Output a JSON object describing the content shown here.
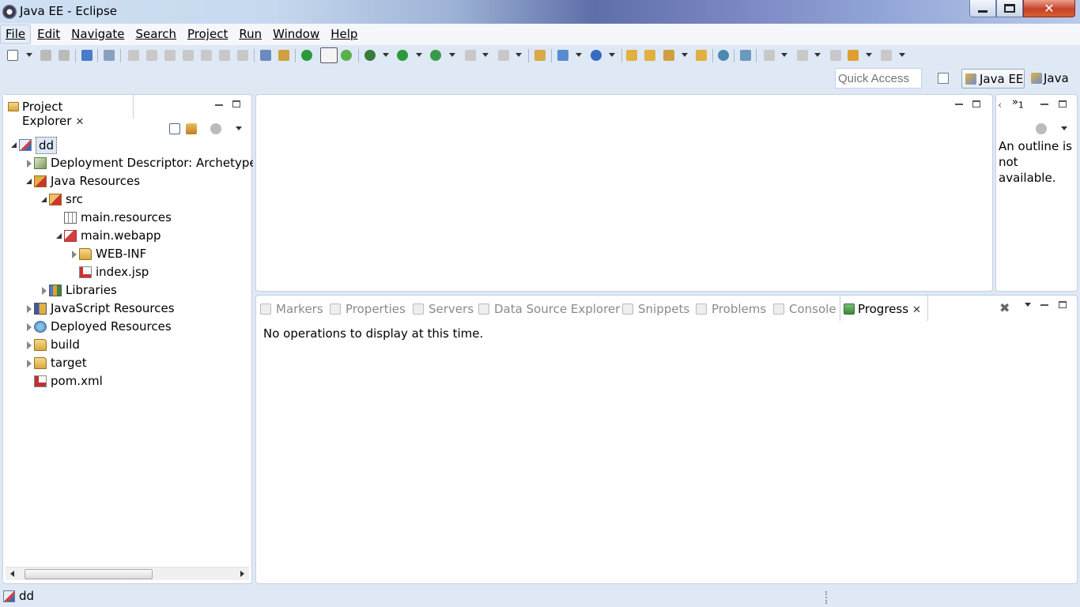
{
  "window": {
    "title": "Java EE - Eclipse",
    "close_glyph": "✕"
  },
  "menu": [
    "File",
    "Edit",
    "Navigate",
    "Search",
    "Project",
    "Run",
    "Window",
    "Help"
  ],
  "quick_access": {
    "placeholder": "Quick Access"
  },
  "perspectives": {
    "active": "Java EE",
    "other": "Java"
  },
  "project_explorer": {
    "title": "Project Explorer",
    "tree": [
      {
        "label": "dd",
        "depth": 0,
        "state": "expanded",
        "icon": "maven-web-project-icon"
      },
      {
        "label": "Deployment Descriptor: Archetype",
        "depth": 1,
        "state": "collapsed",
        "icon": "deployment-descriptor-icon"
      },
      {
        "label": "Java Resources",
        "depth": 1,
        "state": "expanded",
        "icon": "java-resources-icon"
      },
      {
        "label": "src",
        "depth": 2,
        "state": "expanded",
        "icon": "source-folder-icon"
      },
      {
        "label": "main.resources",
        "depth": 3,
        "state": "none",
        "icon": "package-icon"
      },
      {
        "label": "main.webapp",
        "depth": 3,
        "state": "expanded",
        "icon": "package-error-icon"
      },
      {
        "label": "WEB-INF",
        "depth": 4,
        "state": "collapsed",
        "icon": "folder-icon"
      },
      {
        "label": "index.jsp",
        "depth": 4,
        "state": "none",
        "icon": "jsp-file-icon"
      },
      {
        "label": "Libraries",
        "depth": 2,
        "state": "collapsed",
        "icon": "libraries-icon"
      },
      {
        "label": "JavaScript Resources",
        "depth": 1,
        "state": "collapsed",
        "icon": "javascript-resources-icon"
      },
      {
        "label": "Deployed Resources",
        "depth": 1,
        "state": "collapsed",
        "icon": "deployed-resources-icon"
      },
      {
        "label": "build",
        "depth": 1,
        "state": "collapsed",
        "icon": "folder-icon"
      },
      {
        "label": "target",
        "depth": 1,
        "state": "collapsed",
        "icon": "folder-icon"
      },
      {
        "label": "pom.xml",
        "depth": 1,
        "state": "none",
        "icon": "pom-file-icon"
      }
    ]
  },
  "outline": {
    "chevron_label": "»",
    "hidden_count": "1",
    "message": "An outline is not available."
  },
  "bottom_tabs": [
    {
      "label": "Markers",
      "icon": "markers-icon",
      "active": false
    },
    {
      "label": "Properties",
      "icon": "properties-icon",
      "active": false
    },
    {
      "label": "Servers",
      "icon": "servers-icon",
      "active": false
    },
    {
      "label": "Data Source Explorer",
      "icon": "data-source-icon",
      "active": false
    },
    {
      "label": "Snippets",
      "icon": "snippets-icon",
      "active": false
    },
    {
      "label": "Problems",
      "icon": "problems-icon",
      "active": false
    },
    {
      "label": "Console",
      "icon": "console-icon",
      "active": false
    },
    {
      "label": "Progress",
      "icon": "progress-icon",
      "active": true
    }
  ],
  "progress": {
    "message": "No operations to display at this time."
  },
  "status": {
    "text": "dd"
  },
  "colors": {
    "chrome": "#dfe9f5",
    "panel_border": "#c4d0e0",
    "inactive_tab_text": "#8a8a8a"
  }
}
